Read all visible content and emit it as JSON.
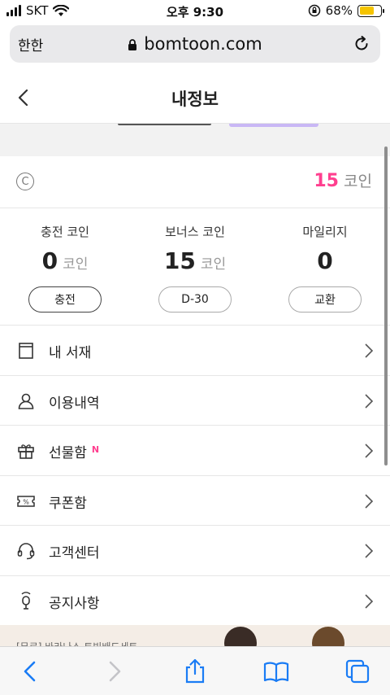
{
  "status_bar": {
    "carrier": "SKT",
    "time": "오후 9:30",
    "battery": "68%",
    "battery_level": 0.68
  },
  "url_bar": {
    "aa": "한한",
    "url": "bomtoon.com"
  },
  "header": {
    "title": "내정보"
  },
  "coins": {
    "total_value": "15",
    "total_unit": "코인"
  },
  "stats": [
    {
      "label": "충전 코인",
      "value": "0",
      "unit": "코인",
      "button": "충전"
    },
    {
      "label": "보너스 코인",
      "value": "15",
      "unit": "코인",
      "button": "D-30"
    },
    {
      "label": "마일리지",
      "value": "0",
      "unit": "",
      "button": "교환"
    }
  ],
  "menu": [
    {
      "label": "내 서재",
      "icon": "book-icon"
    },
    {
      "label": "이용내역",
      "icon": "person-icon"
    },
    {
      "label": "선물함",
      "icon": "gift-icon",
      "badge": "N"
    },
    {
      "label": "쿠폰함",
      "icon": "coupon-icon"
    },
    {
      "label": "고객센터",
      "icon": "headset-icon"
    },
    {
      "label": "공지사항",
      "icon": "microphone-icon"
    }
  ],
  "ad": {
    "text": "[무료] 바라나스 트빙배드세트"
  },
  "colors": {
    "accent": "#ff3f8f",
    "battery": "#f5c400",
    "safari_blue": "#1a7cf5"
  }
}
